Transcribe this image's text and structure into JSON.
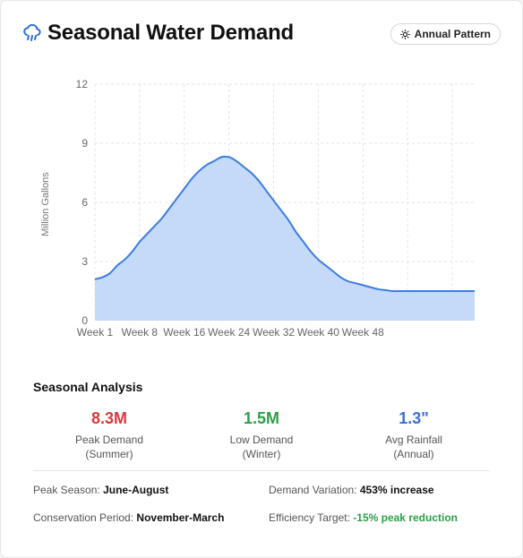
{
  "header": {
    "title": "Seasonal Water Demand",
    "icon": "cloud-rain-icon",
    "pattern_button": "Annual Pattern",
    "pattern_icon": "sun-icon"
  },
  "chart_data": {
    "type": "area",
    "ylabel": "Million Gallons",
    "xlabel": "",
    "ylim": [
      0,
      12
    ],
    "yticks": [
      0,
      3,
      6,
      9,
      12
    ],
    "xlim": [
      1,
      52
    ],
    "x_tick_labels": [
      "Week 1",
      "Week 8",
      "Week 16",
      "Week 24",
      "Week 32",
      "Week 40",
      "Week 48"
    ],
    "x_tick_values": [
      1,
      7,
      13,
      19,
      25,
      31,
      37,
      43,
      49
    ],
    "grid": true,
    "fill_color": "#c5d9f8",
    "line_color": "#3b7de0",
    "series": [
      {
        "x": [
          1,
          2,
          3,
          4,
          5,
          6,
          7,
          8,
          9,
          10,
          11,
          12,
          13,
          14,
          15,
          16,
          17,
          18,
          19,
          20,
          21,
          22,
          23,
          24,
          25,
          26,
          27,
          28,
          29,
          30,
          31,
          32,
          33,
          34,
          35,
          36,
          37,
          38,
          39,
          40,
          41,
          42,
          43,
          44,
          45,
          46,
          47,
          48,
          49,
          50,
          51,
          52
        ],
        "values": [
          2.1,
          2.2,
          2.4,
          2.8,
          3.1,
          3.5,
          4.0,
          4.4,
          4.8,
          5.2,
          5.7,
          6.2,
          6.7,
          7.2,
          7.6,
          7.9,
          8.1,
          8.3,
          8.3,
          8.1,
          7.8,
          7.5,
          7.1,
          6.6,
          6.1,
          5.6,
          5.1,
          4.5,
          4.0,
          3.5,
          3.1,
          2.8,
          2.5,
          2.2,
          2.0,
          1.9,
          1.8,
          1.7,
          1.6,
          1.55,
          1.5,
          1.5,
          1.5,
          1.5,
          1.5,
          1.5,
          1.5,
          1.5,
          1.5,
          1.5,
          1.5,
          1.5
        ]
      }
    ]
  },
  "analysis": {
    "title": "Seasonal Analysis",
    "stats": [
      {
        "value": "8.3M",
        "label1": "Peak Demand",
        "label2": "(Summer)",
        "color": "#d93a3a"
      },
      {
        "value": "1.5M",
        "label1": "Low Demand",
        "label2": "(Winter)",
        "color": "#2e9e49"
      },
      {
        "value": "1.3\"",
        "label1": "Avg Rainfall",
        "label2": "(Annual)",
        "color": "#3b6fd8"
      }
    ],
    "peak_season_label": "Peak Season:",
    "peak_season_value": "June-August",
    "demand_variation_label": "Demand Variation:",
    "demand_variation_value": "453% increase",
    "conservation_label": "Conservation Period:",
    "conservation_value": "November-March",
    "efficiency_label": "Efficiency Target:",
    "efficiency_value": "-15% peak reduction"
  }
}
